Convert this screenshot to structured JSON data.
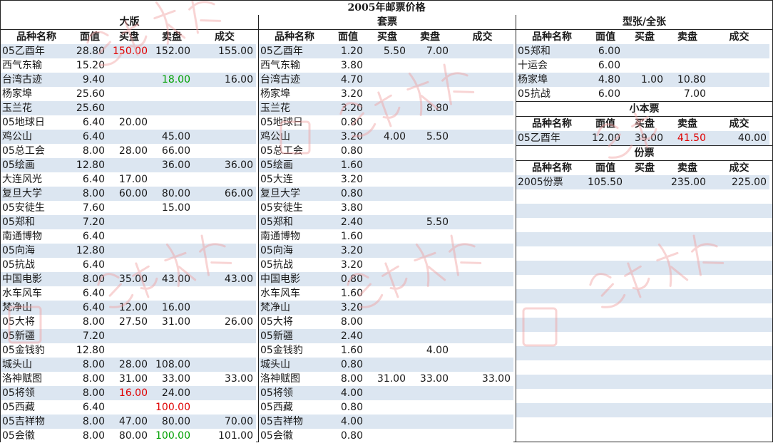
{
  "title": "2005年邮票价格",
  "large": {
    "title": "大版",
    "headers": [
      "品种名称",
      "面值",
      "买盘",
      "卖盘",
      "成交"
    ],
    "rows": [
      [
        "05乙酉年",
        "28.80",
        "150.00",
        "152.00",
        "155.00"
      ],
      [
        "西气东输",
        "15.20",
        "",
        "",
        ""
      ],
      [
        "台湾古迹",
        "9.40",
        "",
        "18.00",
        "16.00"
      ],
      [
        "杨家埠",
        "25.60",
        "",
        "",
        ""
      ],
      [
        "玉兰花",
        "25.60",
        "",
        "",
        ""
      ],
      [
        "05地球日",
        "6.40",
        "20.00",
        "",
        ""
      ],
      [
        "鸡公山",
        "6.40",
        "",
        "45.00",
        ""
      ],
      [
        "05总工会",
        "8.00",
        "28.00",
        "66.00",
        ""
      ],
      [
        "05绘画",
        "12.80",
        "",
        "36.00",
        "36.00"
      ],
      [
        "大连风光",
        "6.40",
        "17.00",
        "",
        ""
      ],
      [
        "复旦大学",
        "8.00",
        "60.00",
        "80.00",
        "66.00"
      ],
      [
        "05安徒生",
        "7.60",
        "",
        "15.00",
        ""
      ],
      [
        "05郑和",
        "7.20",
        "",
        "",
        ""
      ],
      [
        "南通博物",
        "6.40",
        "",
        "",
        ""
      ],
      [
        "05向海",
        "12.80",
        "",
        "",
        ""
      ],
      [
        "05抗战",
        "6.40",
        "",
        "",
        ""
      ],
      [
        "中国电影",
        "8.00",
        "35.00",
        "43.00",
        "43.00"
      ],
      [
        "水车风车",
        "6.40",
        "",
        "",
        ""
      ],
      [
        "梵净山",
        "6.40",
        "12.00",
        "16.00",
        ""
      ],
      [
        "05大将",
        "8.00",
        "27.50",
        "31.00",
        "26.00"
      ],
      [
        "05新疆",
        "7.20",
        "",
        "",
        ""
      ],
      [
        "05金钱豹",
        "12.80",
        "",
        "",
        ""
      ],
      [
        "城头山",
        "8.00",
        "28.00",
        "108.00",
        ""
      ],
      [
        "洛神赋图",
        "8.00",
        "31.00",
        "33.00",
        "33.00"
      ],
      [
        "05将领",
        "8.00",
        "16.00",
        "24.00",
        ""
      ],
      [
        "05西藏",
        "6.40",
        "",
        "100.00",
        ""
      ],
      [
        "05吉祥物",
        "8.00",
        "47.00",
        "80.00",
        "70.00"
      ],
      [
        "05会徽",
        "8.00",
        "80.00",
        "100.00",
        "101.00"
      ]
    ]
  },
  "sets": {
    "title": "套票",
    "headers": [
      "品种名称",
      "面值",
      "买盘",
      "卖盘",
      "成交"
    ],
    "rows": [
      [
        "05乙酉年",
        "1.20",
        "5.50",
        "7.00",
        ""
      ],
      [
        "西气东输",
        "3.80",
        "",
        "",
        ""
      ],
      [
        "台湾古迹",
        "4.70",
        "",
        "",
        ""
      ],
      [
        "杨家埠",
        "3.20",
        "",
        "",
        ""
      ],
      [
        "玉兰花",
        "3.20",
        "",
        "8.80",
        ""
      ],
      [
        "05地球日",
        "0.80",
        "",
        "",
        ""
      ],
      [
        "鸡公山",
        "3.20",
        "4.00",
        "5.50",
        ""
      ],
      [
        "05总工会",
        "0.80",
        "",
        "",
        ""
      ],
      [
        "05绘画",
        "1.60",
        "",
        "",
        ""
      ],
      [
        "05大连",
        "3.20",
        "",
        "",
        ""
      ],
      [
        "复旦大学",
        "0.80",
        "",
        "",
        ""
      ],
      [
        "05安徒生",
        "3.80",
        "",
        "",
        ""
      ],
      [
        "05郑和",
        "2.40",
        "",
        "5.50",
        ""
      ],
      [
        "南通博物",
        "1.60",
        "",
        "",
        ""
      ],
      [
        "05向海",
        "3.20",
        "",
        "",
        ""
      ],
      [
        "05抗战",
        "3.20",
        "",
        "",
        ""
      ],
      [
        "中国电影",
        "0.80",
        "",
        "",
        ""
      ],
      [
        "水车风车",
        "1.60",
        "",
        "",
        ""
      ],
      [
        "梵净山",
        "3.20",
        "",
        "",
        ""
      ],
      [
        "05大将",
        "8.00",
        "",
        "",
        ""
      ],
      [
        "05新疆",
        "2.40",
        "",
        "",
        ""
      ],
      [
        "05金钱豹",
        "1.60",
        "",
        "4.00",
        ""
      ],
      [
        "城头山",
        "0.80",
        "",
        "",
        ""
      ],
      [
        "洛神赋图",
        "8.00",
        "31.00",
        "33.00",
        "33.00"
      ],
      [
        "05将领",
        "4.00",
        "",
        "",
        ""
      ],
      [
        "05西藏",
        "0.80",
        "",
        "",
        ""
      ],
      [
        "05吉祥物",
        "4.00",
        "",
        "",
        ""
      ],
      [
        "05会徽",
        "0.80",
        "",
        "",
        ""
      ]
    ]
  },
  "sheetlet": {
    "title": "型张/全张",
    "headers": [
      "品种名称",
      "面值",
      "买盘",
      "卖盘",
      "成交"
    ],
    "rows": [
      [
        "05郑和",
        "6.00",
        "",
        "",
        ""
      ],
      [
        "十运会",
        "6.00",
        "",
        "",
        ""
      ],
      [
        "杨家埠",
        "4.80",
        "1.00",
        "10.80",
        ""
      ],
      [
        "05抗战",
        "6.00",
        "",
        "7.00",
        ""
      ]
    ]
  },
  "booklet": {
    "title": "小本票",
    "headers": [
      "品种名称",
      "面值",
      "买盘",
      "卖盘",
      "成交"
    ],
    "rows": [
      [
        "05乙酉年",
        "12.00",
        "39.00",
        "41.50",
        "40.00"
      ]
    ]
  },
  "yearpack": {
    "title": "份票",
    "headers": [
      "品种名称",
      "面值",
      "买盘",
      "卖盘",
      "成交"
    ],
    "rows": [
      [
        "2005份票",
        "105.50",
        "",
        "235.00",
        "225.00"
      ]
    ]
  },
  "highlights": {
    "red": "#e00000",
    "green": "#00a000",
    "stripe": "#dce6f1",
    "cells": [
      {
        "table": "large",
        "row": 0,
        "col": 2,
        "color": "red"
      },
      {
        "table": "large",
        "row": 2,
        "col": 3,
        "color": "green"
      },
      {
        "table": "large",
        "row": 24,
        "col": 2,
        "color": "red"
      },
      {
        "table": "large",
        "row": 25,
        "col": 3,
        "color": "red"
      },
      {
        "table": "large",
        "row": 27,
        "col": 3,
        "color": "green"
      },
      {
        "table": "booklet",
        "row": 0,
        "col": 3,
        "color": "red"
      }
    ]
  }
}
